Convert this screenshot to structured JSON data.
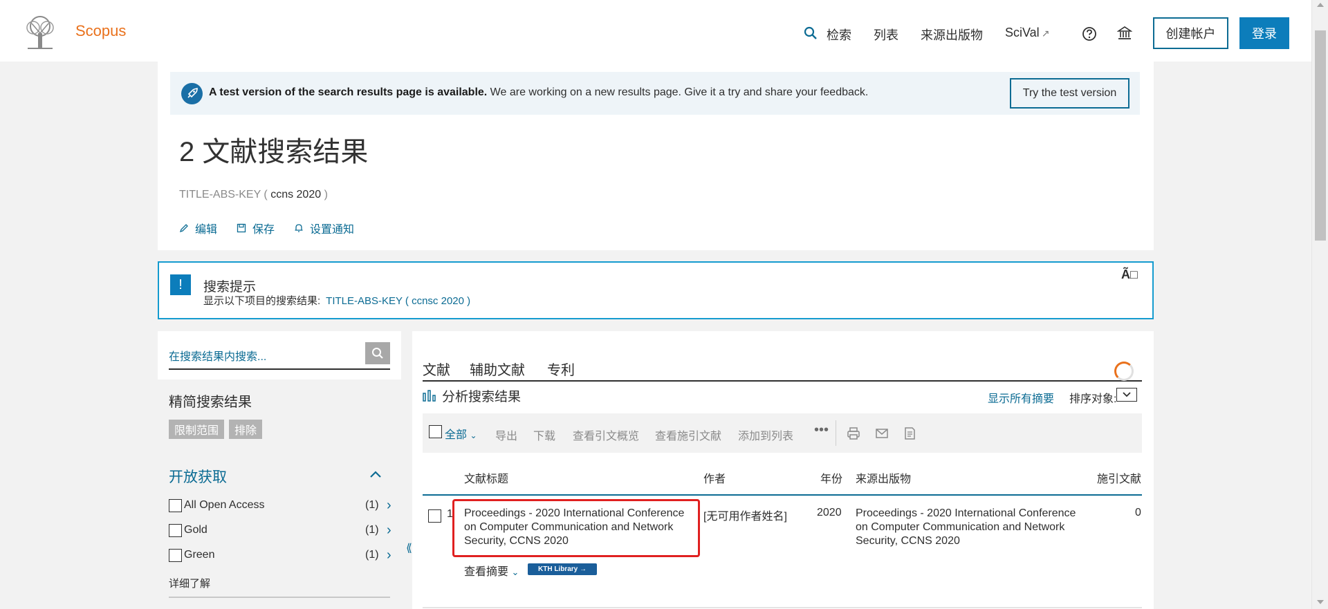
{
  "header": {
    "brand": "Scopus",
    "nav": {
      "search": "检索",
      "list": "列表",
      "sources": "来源出版物",
      "scival": "SciVal",
      "scival_ext": "↗"
    },
    "create_account": "创建帐户",
    "login": "登录"
  },
  "banner": {
    "bold": "A test version of the search results page is available.",
    "text": " We are working on a new results page. Give it a try and share your feedback.",
    "button": "Try the test version"
  },
  "results_header": {
    "title": "2 文献搜索结果",
    "query_field": "TITLE-ABS-KEY ( ",
    "query_terms": "ccns  2020",
    "query_end": " )",
    "actions": {
      "edit": "编辑",
      "save": "保存",
      "alert": "设置通知"
    }
  },
  "tip": {
    "icon": "!",
    "title": "搜索提示",
    "subtitle": "显示以下项目的搜索结果:",
    "link": "TITLE-ABS-KEY ( ccnsc  2020 )",
    "close": "Ã"
  },
  "sidebar": {
    "search_placeholder": "在搜索结果内搜索...",
    "refine_title": "精简搜索结果",
    "limit": "限制范围",
    "exclude": "排除",
    "open_access": "开放获取",
    "oa_items": [
      {
        "label": "All Open Access",
        "count": "(1)"
      },
      {
        "label": "Gold",
        "count": "(1)"
      },
      {
        "label": "Green",
        "count": "(1)"
      }
    ],
    "learn_more": "详细了解"
  },
  "results": {
    "tabs": [
      "文献",
      "辅助文献",
      "专利"
    ],
    "analyze": "分析搜索结果",
    "show_all_abstracts": "显示所有摘要",
    "sort_label": "排序对象:",
    "toolbar": {
      "all": "全部",
      "export": "导出",
      "download": "下载",
      "citation_overview": "查看引文概览",
      "cited_by": "查看施引文献",
      "add_to_list": "添加到列表",
      "more": "•••"
    },
    "columns": {
      "title": "文献标题",
      "authors": "作者",
      "year": "年份",
      "source": "来源出版物",
      "cited": "施引文献"
    },
    "rows": [
      {
        "num": "1",
        "title": "Proceedings - 2020 International Conference on Computer Communication and Network Security, CCNS 2020",
        "authors": "[无可用作者姓名]",
        "year": "2020",
        "source": "Proceedings - 2020 International Conference on Computer Communication and Network Security, CCNS 2020",
        "cited": "0",
        "view_abstract": "查看摘要",
        "library": "KTH Library"
      }
    ]
  }
}
